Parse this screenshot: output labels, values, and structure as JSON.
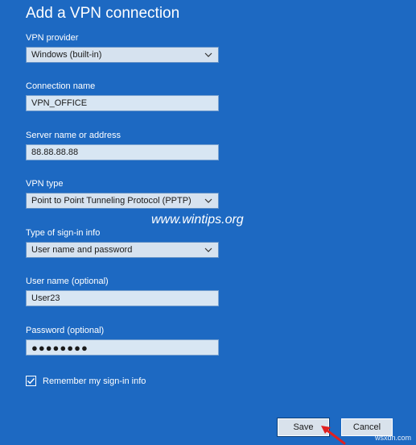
{
  "page": {
    "title": "Add a VPN connection"
  },
  "form": {
    "vpn_provider": {
      "label": "VPN provider",
      "value": "Windows (built-in)"
    },
    "connection_name": {
      "label": "Connection name",
      "value": "VPN_OFFICE"
    },
    "server": {
      "label": "Server name or address",
      "value": "88.88.88.88"
    },
    "vpn_type": {
      "label": "VPN type",
      "value": "Point to Point Tunneling Protocol (PPTP)"
    },
    "sign_in_type": {
      "label": "Type of sign-in info",
      "value": "User name and password"
    },
    "username": {
      "label": "User name (optional)",
      "value": "User23"
    },
    "password": {
      "label": "Password (optional)",
      "value": "●●●●●●●●"
    },
    "remember": {
      "label": "Remember my sign-in info",
      "checked": true
    }
  },
  "buttons": {
    "save": "Save",
    "cancel": "Cancel"
  },
  "watermark": {
    "main": "www.wintips.org",
    "corner": "wsxdn.com"
  },
  "colors": {
    "background": "#1d69c2",
    "annotation_arrow": "#e02020"
  },
  "icons": {
    "dropdown": "chevron-down-icon",
    "check": "checkmark-icon",
    "annotation": "red-arrow-icon"
  }
}
